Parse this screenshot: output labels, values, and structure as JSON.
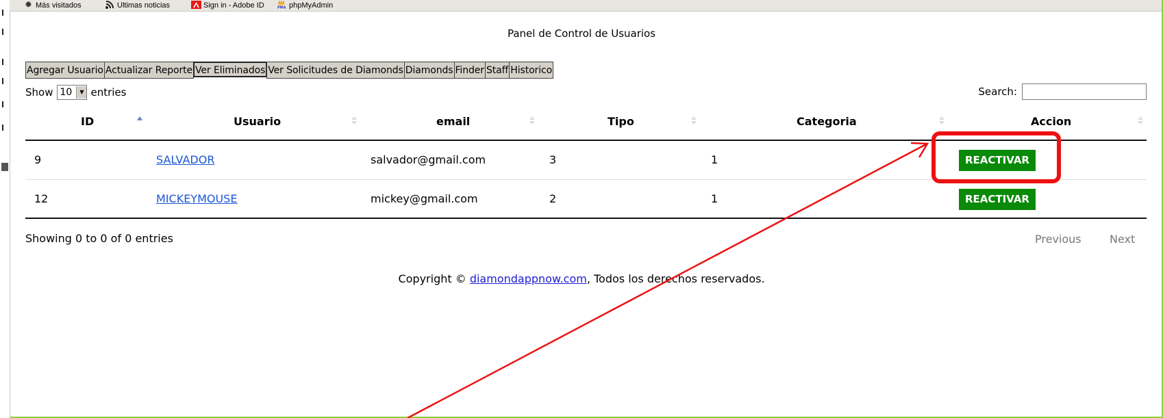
{
  "bookmarks": [
    {
      "label": "Más visitados",
      "icon": "gear-icon"
    },
    {
      "label": "Ultimas noticias",
      "icon": "rss-icon"
    },
    {
      "label": "Sign in - Adobe ID",
      "icon": "adobe-icon"
    },
    {
      "label": "phpMyAdmin",
      "icon": "phpmyadmin-icon"
    }
  ],
  "page_title": "Panel de Control de Usuarios",
  "toolbar": {
    "buttons": [
      "Agregar Usuario",
      "Actualizar Reporte",
      "Ver Eliminados",
      "Ver Solicitudes de Diamonds",
      "Diamonds",
      "Finder",
      "Staff",
      "Historico"
    ],
    "active": "Ver Eliminados"
  },
  "length": {
    "show": "Show",
    "value": "10",
    "entries": "entries"
  },
  "search": {
    "label": "Search:",
    "value": ""
  },
  "table": {
    "headers": [
      "ID",
      "Usuario",
      "email",
      "Tipo",
      "Categoria",
      "Accion"
    ],
    "rows": [
      {
        "id": "9",
        "usuario": "SALVADOR",
        "email": "salvador@gmail.com",
        "tipo": "3",
        "categoria": "1",
        "accion": "REACTIVAR"
      },
      {
        "id": "12",
        "usuario": "MICKEYMOUSE",
        "email": "mickey@gmail.com",
        "tipo": "2",
        "categoria": "1",
        "accion": "REACTIVAR"
      }
    ]
  },
  "info": "Showing 0 to 0 of 0 entries",
  "pagination": {
    "previous": "Previous",
    "next": "Next"
  },
  "footer": {
    "prefix": "Copyright © ",
    "link": "diamondappnow.com",
    "suffix": ", Todos los derechos reservados."
  },
  "colors": {
    "frame": "#8fcf3c",
    "reactivar_bg": "#098a09",
    "annotation": "#ee1111",
    "link": "#1a56d6"
  }
}
